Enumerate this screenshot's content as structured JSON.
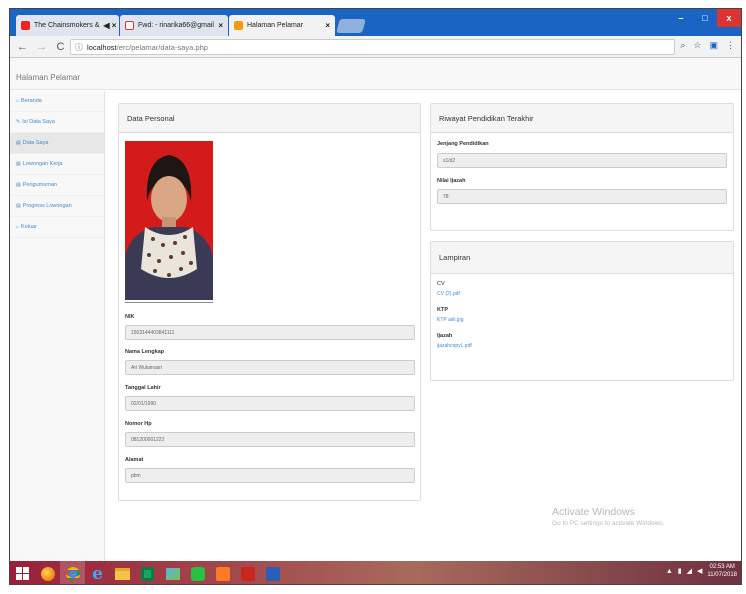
{
  "browser": {
    "tabs": [
      {
        "label": "The Chainsmokers &",
        "extra": "◀ ×"
      },
      {
        "label": "Fwd: - rinarika66@gmail",
        "extra": "×"
      },
      {
        "label": "Halaman Pelamar",
        "extra": "×"
      }
    ],
    "url_host": "localhost",
    "url_path": "/erc/pelamar/data-saya.php",
    "window_buttons": {
      "minimize": "–",
      "maximize": "□",
      "close": "x"
    }
  },
  "app": {
    "brand": "Halaman Pelamar"
  },
  "sidebar": {
    "items": [
      {
        "label": "Beranda",
        "icon": "⌂"
      },
      {
        "label": "Isi Data Saya",
        "icon": "✎"
      },
      {
        "label": "Data Saya",
        "icon": "▤"
      },
      {
        "label": "Lowongan Kerja",
        "icon": "▤"
      },
      {
        "label": "Pengumuman",
        "icon": "▤"
      },
      {
        "label": "Progress Lowongan",
        "icon": "▤"
      },
      {
        "label": "Keluar",
        "icon": "⌂"
      }
    ]
  },
  "personal": {
    "title": "Data Personal",
    "fields": [
      {
        "label": "NIK",
        "value": "1503144403841111"
      },
      {
        "label": "Nama Lengkap",
        "value": "Ari Wulamasri"
      },
      {
        "label": "Tanggal Lahir",
        "value": "02/01/1990"
      },
      {
        "label": "Nomor Hp",
        "value": "081200001222"
      },
      {
        "label": "Alamat",
        "value": "pbm"
      }
    ]
  },
  "education": {
    "title": "Riwayat Pendidikan Terakhir",
    "fields": [
      {
        "label": "Jenjang Pendidikan",
        "value": "s1/d2"
      },
      {
        "label": "Nilai Ijazah",
        "value": "78"
      }
    ]
  },
  "attachments": {
    "title": "Lampiran",
    "items": [
      {
        "label": "CV",
        "file": "CV (2).pdf"
      },
      {
        "label": "KTP",
        "file": "KTP asli.jpg"
      },
      {
        "label": "Ijazah",
        "file": "ijazahcopyL.pdf"
      }
    ]
  },
  "watermark": {
    "line1": "Activate Windows",
    "line2": "Go to PC settings to activate Windows."
  },
  "taskbar": {
    "time": "02:53 AM",
    "date": "11/07/2018"
  },
  "colors": {
    "tabbar": "#1a65c3",
    "link": "#428bca",
    "photo_bg": "#d41b1b"
  }
}
